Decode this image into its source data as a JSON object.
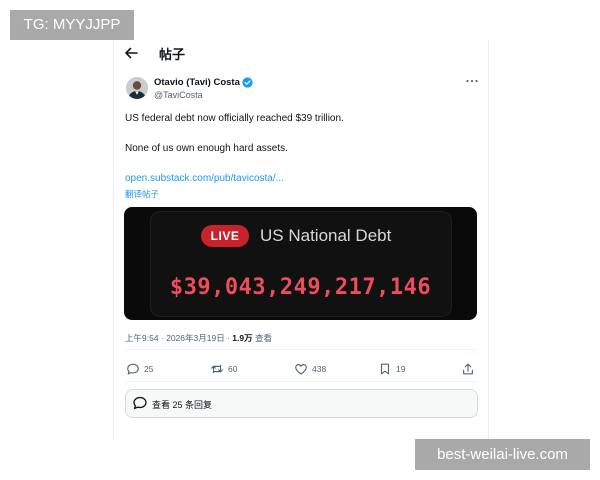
{
  "watermarks": {
    "top_left": "TG: MYYJJPP",
    "bottom_right": "best-weilai-live.com"
  },
  "header": {
    "title": "帖子",
    "back_icon": "arrow-left-icon"
  },
  "author": {
    "name": "Otavio (Tavi) Costa",
    "handle": "@TaviCosta",
    "verified": true,
    "verified_color": "#1d9bf0",
    "more_icon": "more-horizontal-icon"
  },
  "tweet": {
    "lines": [
      "US federal debt now officially reached $39 trillion.",
      "None of us own enough hard assets."
    ],
    "link": "open.substack.com/pub/tavicosta/...",
    "translate": "翻译帖子"
  },
  "media": {
    "live_label": "LIVE",
    "title": "US National Debt",
    "value": "$39,043,249,217,146",
    "live_color": "#c8232b",
    "value_color": "#ec4e5b"
  },
  "meta": {
    "time_date": "上午9:54 · 2026年3月19日 · ",
    "views": "1.9万",
    "views_label": " 查看"
  },
  "actions": {
    "replies": "25",
    "reposts": "60",
    "likes": "438",
    "bookmarks": "19"
  },
  "reply_bar": {
    "label": "查看 25 条回复",
    "icon": "chat-bubble-icon"
  },
  "colors": {
    "accent": "#1d9bf0",
    "text": "#0f1419",
    "secondary": "#536471"
  }
}
